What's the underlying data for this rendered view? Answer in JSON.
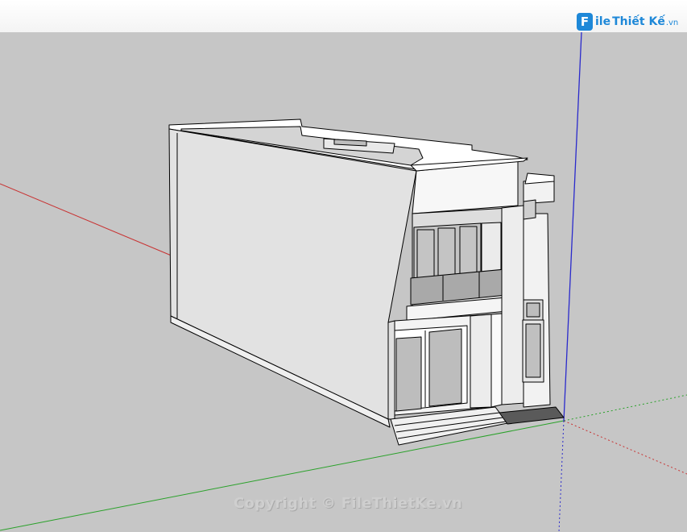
{
  "viewport": {
    "colors": {
      "sky": "#ffffff",
      "ground": "#c6c6c6",
      "red_axis": "#c83232",
      "green_axis": "#2aa12a",
      "blue_axis": "#2a2acc",
      "edge": "#000000",
      "wall_light": "#ffffff",
      "wall_shade": "#dedede",
      "glass": "#bfbfbf"
    },
    "axes": [
      "red-axis",
      "green-axis",
      "blue-axis"
    ],
    "model": "two-storey-house"
  },
  "logo": {
    "badge": "F",
    "file": "ile",
    "thietke": "Thiết Kế",
    "tld": ".vn"
  },
  "watermark": {
    "copyright": "Copyright © FileThietKe.vn"
  }
}
